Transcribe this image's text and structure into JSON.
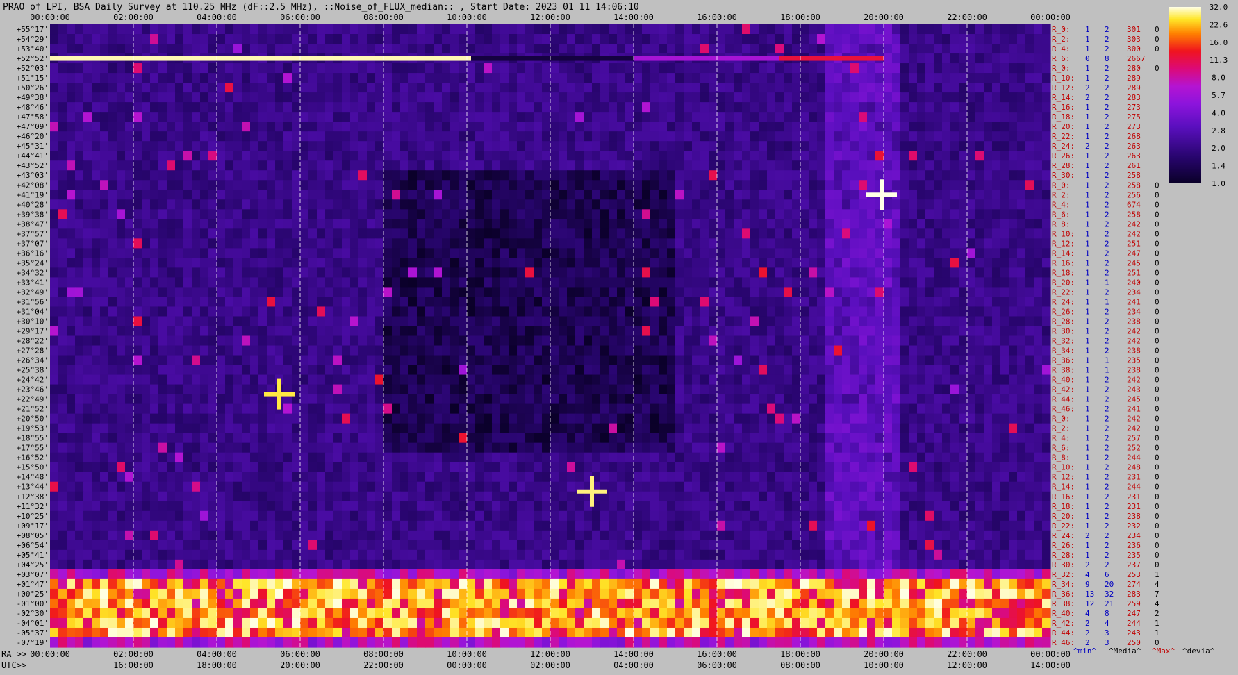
{
  "title": "PRAO of LPI, BSA Daily Survey at 110.25 MHz (dF::2.5 MHz), ::Noise_of_FLUX_median:: , Start Date: 2023 01 11 14:06:10",
  "colors": {
    "background": "#c0c0c0",
    "text": "#000000",
    "right_label": "#c00000",
    "right_value": "#0000c0"
  },
  "chart_data": {
    "type": "heatmap",
    "top_time_labels": [
      "00:00:00",
      "02:00:00",
      "04:00:00",
      "06:00:00",
      "08:00:00",
      "10:00:00",
      "12:00:00",
      "14:00:00",
      "16:00:00",
      "18:00:00",
      "20:00:00",
      "22:00:00",
      "00:00:00"
    ],
    "bottom_ra_labels": [
      "00:00:00",
      "02:00:00",
      "04:00:00",
      "06:00:00",
      "08:00:00",
      "10:00:00",
      "12:00:00",
      "14:00:00",
      "16:00:00",
      "18:00:00",
      "20:00:00",
      "22:00:00",
      "00:00:00"
    ],
    "bottom_utc_labels": [
      "16:00:00",
      "18:00:00",
      "20:00:00",
      "22:00:00",
      "00:00:00",
      "02:00:00",
      "04:00:00",
      "06:00:00",
      "08:00:00",
      "10:00:00",
      "12:00:00",
      "14:00:00"
    ],
    "ra_prefix": "RA >>",
    "utc_prefix": "UTC>>",
    "dec_labels": [
      "+55°17'",
      "+54°29'",
      "+53°40'",
      "+52°52'",
      "+52°03'",
      "+51°15'",
      "+50°26'",
      "+49°38'",
      "+48°46'",
      "+47°58'",
      "+47°09'",
      "+46°20'",
      "+45°31'",
      "+44°41'",
      "+43°52'",
      "+43°03'",
      "+42°08'",
      "+41°19'",
      "+40°28'",
      "+39°38'",
      "+38°47'",
      "+37°57'",
      "+37°07'",
      "+36°16'",
      "+35°24'",
      "+34°32'",
      "+33°41'",
      "+32°49'",
      "+31°56'",
      "+31°04'",
      "+30°10'",
      "+29°17'",
      "+28°22'",
      "+27°28'",
      "+26°34'",
      "+25°38'",
      "+24°42'",
      "+23°46'",
      "+22°49'",
      "+21°52'",
      "+20°50'",
      "+19°53'",
      "+18°55'",
      "+17°55'",
      "+16°52'",
      "+15°50'",
      "+14°48'",
      "+13°44'",
      "+12°38'",
      "+11°32'",
      "+10°25'",
      "+09°17'",
      "+08°05'",
      "+06°54'",
      "+05°41'",
      "+04°25'",
      "+03°07'",
      "+01°47'",
      "+00°25'",
      "-01°00'",
      "-02°30'",
      "-04°01'",
      "-05°37'",
      "-07°19'"
    ],
    "colorbar": {
      "ticks": [
        "32.0",
        "22.6",
        "16.0",
        "11.3",
        "8.0",
        "5.7",
        "4.0",
        "2.8",
        "2.0",
        "1.4",
        "1.0"
      ],
      "range": [
        1.0,
        32.0
      ]
    },
    "row_stats": [
      {
        "label": "R_0:",
        "m": "1",
        "D": "2",
        "M": "301",
        "d": "0"
      },
      {
        "label": "R_2:",
        "m": "1",
        "D": "2",
        "M": "303",
        "d": "0"
      },
      {
        "label": "R_4:",
        "m": "1",
        "D": "2",
        "M": "300",
        "d": "0"
      },
      {
        "label": "R_6:",
        "m": "0",
        "D": "8",
        "M": "2667",
        "d": ""
      },
      {
        "label": "R_0:",
        "m": "1",
        "D": "2",
        "M": "280",
        "d": "0"
      },
      {
        "label": "R_10:",
        "m": "1",
        "D": "2",
        "M": "289",
        "d": ""
      },
      {
        "label": "R_12:",
        "m": "2",
        "D": "2",
        "M": "289",
        "d": ""
      },
      {
        "label": "R_14:",
        "m": "2",
        "D": "2",
        "M": "283",
        "d": ""
      },
      {
        "label": "R_16:",
        "m": "1",
        "D": "2",
        "M": "273",
        "d": ""
      },
      {
        "label": "R_18:",
        "m": "1",
        "D": "2",
        "M": "275",
        "d": ""
      },
      {
        "label": "R_20:",
        "m": "1",
        "D": "2",
        "M": "273",
        "d": ""
      },
      {
        "label": "R_22:",
        "m": "1",
        "D": "2",
        "M": "268",
        "d": ""
      },
      {
        "label": "R_24:",
        "m": "2",
        "D": "2",
        "M": "263",
        "d": ""
      },
      {
        "label": "R_26:",
        "m": "1",
        "D": "2",
        "M": "263",
        "d": ""
      },
      {
        "label": "R_28:",
        "m": "1",
        "D": "2",
        "M": "261",
        "d": ""
      },
      {
        "label": "R_30:",
        "m": "1",
        "D": "2",
        "M": "258",
        "d": ""
      },
      {
        "label": "R_0:",
        "m": "1",
        "D": "2",
        "M": "258",
        "d": "0"
      },
      {
        "label": "R_2:",
        "m": "1",
        "D": "2",
        "M": "256",
        "d": "0"
      },
      {
        "label": "R_4:",
        "m": "1",
        "D": "2",
        "M": "674",
        "d": "0"
      },
      {
        "label": "R_6:",
        "m": "1",
        "D": "2",
        "M": "258",
        "d": "0"
      },
      {
        "label": "R_8:",
        "m": "1",
        "D": "2",
        "M": "242",
        "d": "0"
      },
      {
        "label": "R_10:",
        "m": "1",
        "D": "2",
        "M": "242",
        "d": "0"
      },
      {
        "label": "R_12:",
        "m": "1",
        "D": "2",
        "M": "251",
        "d": "0"
      },
      {
        "label": "R_14:",
        "m": "1",
        "D": "2",
        "M": "247",
        "d": "0"
      },
      {
        "label": "R_16:",
        "m": "1",
        "D": "2",
        "M": "245",
        "d": "0"
      },
      {
        "label": "R_18:",
        "m": "1",
        "D": "2",
        "M": "251",
        "d": "0"
      },
      {
        "label": "R_20:",
        "m": "1",
        "D": "1",
        "M": "240",
        "d": "0"
      },
      {
        "label": "R_22:",
        "m": "1",
        "D": "2",
        "M": "234",
        "d": "0"
      },
      {
        "label": "R_24:",
        "m": "1",
        "D": "1",
        "M": "241",
        "d": "0"
      },
      {
        "label": "R_26:",
        "m": "1",
        "D": "2",
        "M": "234",
        "d": "0"
      },
      {
        "label": "R_28:",
        "m": "1",
        "D": "2",
        "M": "238",
        "d": "0"
      },
      {
        "label": "R_30:",
        "m": "1",
        "D": "2",
        "M": "242",
        "d": "0"
      },
      {
        "label": "R_32:",
        "m": "1",
        "D": "2",
        "M": "242",
        "d": "0"
      },
      {
        "label": "R_34:",
        "m": "1",
        "D": "2",
        "M": "238",
        "d": "0"
      },
      {
        "label": "R_36:",
        "m": "1",
        "D": "1",
        "M": "235",
        "d": "0"
      },
      {
        "label": "R_38:",
        "m": "1",
        "D": "1",
        "M": "238",
        "d": "0"
      },
      {
        "label": "R_40:",
        "m": "1",
        "D": "2",
        "M": "242",
        "d": "0"
      },
      {
        "label": "R_42:",
        "m": "1",
        "D": "2",
        "M": "243",
        "d": "0"
      },
      {
        "label": "R_44:",
        "m": "1",
        "D": "2",
        "M": "245",
        "d": "0"
      },
      {
        "label": "R_46:",
        "m": "1",
        "D": "2",
        "M": "241",
        "d": "0"
      },
      {
        "label": "R_0:",
        "m": "1",
        "D": "2",
        "M": "242",
        "d": "0"
      },
      {
        "label": "R_2:",
        "m": "1",
        "D": "2",
        "M": "242",
        "d": "0"
      },
      {
        "label": "R_4:",
        "m": "1",
        "D": "2",
        "M": "257",
        "d": "0"
      },
      {
        "label": "R_6:",
        "m": "1",
        "D": "2",
        "M": "252",
        "d": "0"
      },
      {
        "label": "R_8:",
        "m": "1",
        "D": "2",
        "M": "244",
        "d": "0"
      },
      {
        "label": "R_10:",
        "m": "1",
        "D": "2",
        "M": "248",
        "d": "0"
      },
      {
        "label": "R_12:",
        "m": "1",
        "D": "2",
        "M": "231",
        "d": "0"
      },
      {
        "label": "R_14:",
        "m": "1",
        "D": "2",
        "M": "244",
        "d": "0"
      },
      {
        "label": "R_16:",
        "m": "1",
        "D": "2",
        "M": "231",
        "d": "0"
      },
      {
        "label": "R_18:",
        "m": "1",
        "D": "2",
        "M": "231",
        "d": "0"
      },
      {
        "label": "R_20:",
        "m": "1",
        "D": "2",
        "M": "238",
        "d": "0"
      },
      {
        "label": "R_22:",
        "m": "1",
        "D": "2",
        "M": "232",
        "d": "0"
      },
      {
        "label": "R_24:",
        "m": "2",
        "D": "2",
        "M": "234",
        "d": "0"
      },
      {
        "label": "R_26:",
        "m": "1",
        "D": "2",
        "M": "236",
        "d": "0"
      },
      {
        "label": "R_28:",
        "m": "1",
        "D": "2",
        "M": "235",
        "d": "0"
      },
      {
        "label": "R_30:",
        "m": "2",
        "D": "2",
        "M": "237",
        "d": "0"
      },
      {
        "label": "R_32:",
        "m": "4",
        "D": "6",
        "M": "253",
        "d": "1"
      },
      {
        "label": "R_34:",
        "m": "9",
        "D": "20",
        "M": "274",
        "d": "4"
      },
      {
        "label": "R_36:",
        "m": "13",
        "D": "32",
        "M": "283",
        "d": "7"
      },
      {
        "label": "R_38:",
        "m": "12",
        "D": "21",
        "M": "259",
        "d": "4"
      },
      {
        "label": "R_40:",
        "m": "4",
        "D": "8",
        "M": "247",
        "d": "2"
      },
      {
        "label": "R_42:",
        "m": "2",
        "D": "4",
        "M": "244",
        "d": "1"
      },
      {
        "label": "R_44:",
        "m": "2",
        "D": "3",
        "M": "243",
        "d": "1"
      },
      {
        "label": "R_46:",
        "m": "2",
        "D": "3",
        "M": "250",
        "d": "0"
      }
    ],
    "stats_footer": [
      "^min^",
      "^Media^",
      "^Max^",
      "^devia^"
    ],
    "features": [
      {
        "kind": "hline",
        "dec_row": 3,
        "t0": 0.0,
        "t1": 10.1,
        "level": 30
      },
      {
        "kind": "hline",
        "dec_row": 3,
        "t0": 10.1,
        "t1": 14.0,
        "level": 1.2
      },
      {
        "kind": "hline",
        "dec_row": 3,
        "t0": 14.0,
        "t1": 17.5,
        "level": 6
      },
      {
        "kind": "hline",
        "dec_row": 3,
        "t0": 17.5,
        "t1": 20.0,
        "level": 12
      },
      {
        "kind": "source",
        "t": 19.95,
        "dec_row": 17.5,
        "level": 32
      },
      {
        "kind": "source",
        "t": 13.0,
        "dec_row": 48.0,
        "level": 28
      },
      {
        "kind": "source",
        "t": 5.5,
        "dec_row": 38.0,
        "level": 26
      }
    ]
  }
}
